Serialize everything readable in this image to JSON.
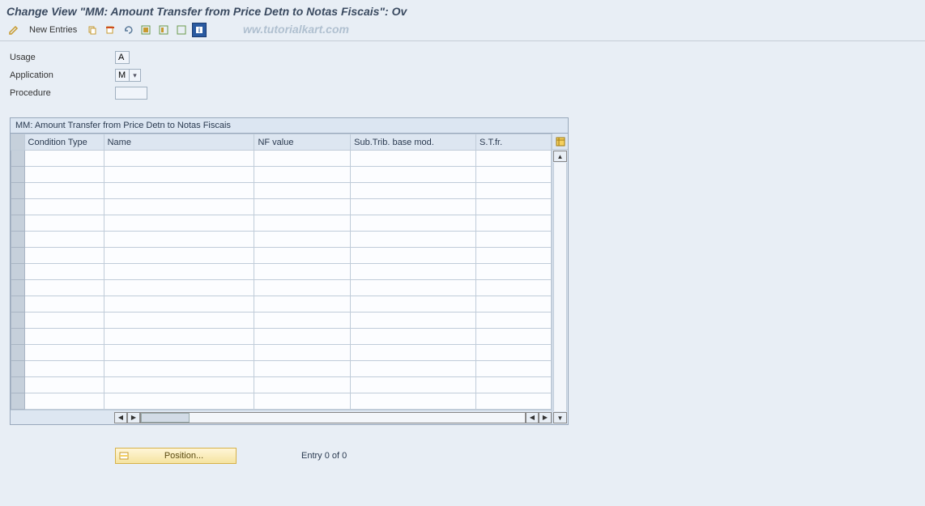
{
  "title": "Change View \"MM: Amount Transfer from Price Detn to Notas Fiscais\": Ov",
  "toolbar": {
    "new_entries": "New Entries",
    "icons": {
      "edit": "✎",
      "copy": "⧉",
      "delete": "✕",
      "undo": "⟲",
      "select_all": "▦",
      "select_block": "▥",
      "deselect": "▤",
      "info": "ℹ"
    }
  },
  "watermark": "ww.tutorialkart.com",
  "form": {
    "usage": {
      "label": "Usage",
      "value": "A"
    },
    "application": {
      "label": "Application",
      "value": "M"
    },
    "procedure": {
      "label": "Procedure",
      "value": ""
    }
  },
  "table": {
    "title": "MM: Amount Transfer from Price Detn to Notas Fiscais",
    "columns": {
      "cond": "Condition Type",
      "name": "Name",
      "nf": "NF value",
      "sub": "Sub.Trib. base mod.",
      "st": "S.T.fr."
    },
    "row_count": 16
  },
  "footer": {
    "position_label": "Position...",
    "entry_text": "Entry 0 of 0"
  }
}
